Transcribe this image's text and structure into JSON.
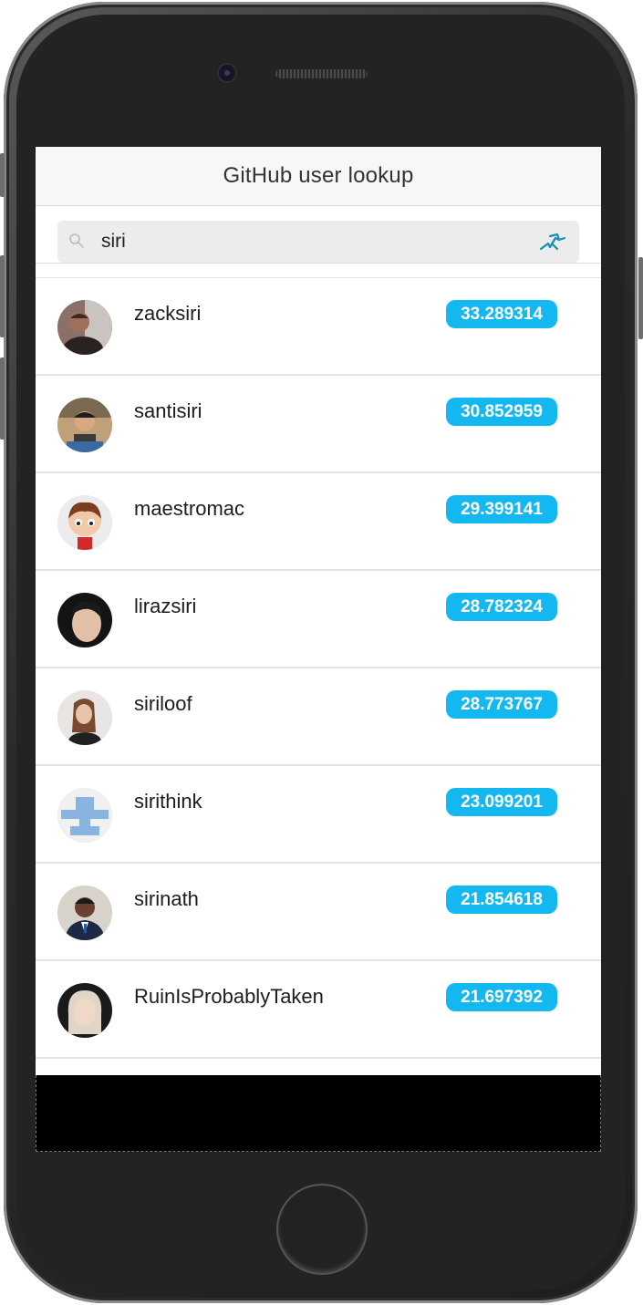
{
  "nav": {
    "title": "GitHub user lookup"
  },
  "search": {
    "value": "siri",
    "search_icon": "search-icon",
    "status_icon": "loading-runner-icon"
  },
  "colors": {
    "badge": "#14b8f0",
    "navbar": "#f7f7f7"
  },
  "users": [
    {
      "login": "zacksiri",
      "score": "33.289314"
    },
    {
      "login": "santisiri",
      "score": "30.852959"
    },
    {
      "login": "maestromac",
      "score": "29.399141"
    },
    {
      "login": "lirazsiri",
      "score": "28.782324"
    },
    {
      "login": "siriloof",
      "score": "28.773767"
    },
    {
      "login": "sirithink",
      "score": "23.099201"
    },
    {
      "login": "sirinath",
      "score": "21.854618"
    },
    {
      "login": "RuinIsProbablyTaken",
      "score": "21.697392"
    }
  ]
}
